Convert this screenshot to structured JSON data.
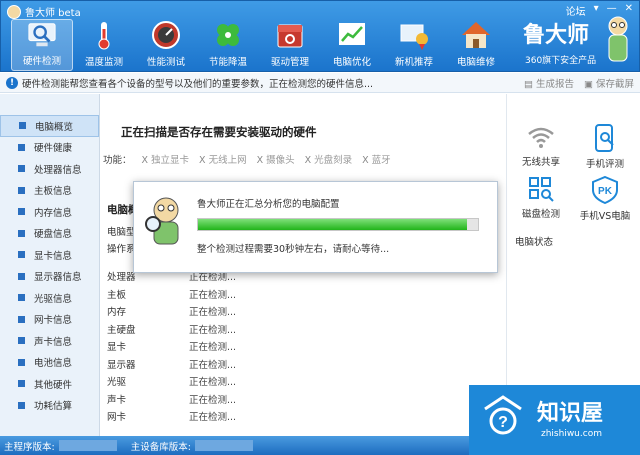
{
  "app": {
    "title": "鲁大师 beta",
    "window_controls": [
      "论坛",
      "▾",
      "—",
      "✕"
    ]
  },
  "nav": {
    "items": [
      {
        "label": "硬件检测",
        "icon": "hardware-check-icon",
        "active": true
      },
      {
        "label": "温度监测",
        "icon": "thermometer-icon",
        "active": false
      },
      {
        "label": "性能测试",
        "icon": "gauge-icon",
        "active": false
      },
      {
        "label": "节能降温",
        "icon": "clover-icon",
        "active": false
      },
      {
        "label": "驱动管理",
        "icon": "driver-box-icon",
        "active": false
      },
      {
        "label": "电脑优化",
        "icon": "chart-icon",
        "active": false
      },
      {
        "label": "新机推荐",
        "icon": "computer-award-icon",
        "active": false
      },
      {
        "label": "电脑维修",
        "icon": "house-icon",
        "active": false
      }
    ]
  },
  "brand": {
    "name": "鲁大师",
    "subtitle": "360旗下安全产品"
  },
  "infobar": {
    "text": "硬件检测能帮您查看各个设备的型号以及他们的重要参数，正在检测您的硬件信息...",
    "actions": [
      "生成报告",
      "保存截屏"
    ]
  },
  "sidebar": {
    "items": [
      {
        "label": "电脑概览",
        "active": true
      },
      {
        "label": "硬件健康"
      },
      {
        "label": "处理器信息"
      },
      {
        "label": "主板信息"
      },
      {
        "label": "内存信息"
      },
      {
        "label": "硬盘信息"
      },
      {
        "label": "显卡信息"
      },
      {
        "label": "显示器信息"
      },
      {
        "label": "光驱信息"
      },
      {
        "label": "网卡信息"
      },
      {
        "label": "声卡信息"
      },
      {
        "label": "电池信息"
      },
      {
        "label": "其他硬件"
      },
      {
        "label": "功耗估算"
      }
    ]
  },
  "main": {
    "scan_title": "正在扫描是否存在需要安装驱动的硬件",
    "functions_label": "功能：",
    "functions": [
      "独立显卡",
      "无线上网",
      "摄像头",
      "光盘刻录",
      "蓝牙"
    ],
    "section_title": "电脑概览",
    "partial_rows": [
      "电脑型号",
      "操作系统"
    ],
    "rows": [
      {
        "key": "处理器",
        "value": "正在检测..."
      },
      {
        "key": "主板",
        "value": "正在检测..."
      },
      {
        "key": "内存",
        "value": "正在检测..."
      },
      {
        "key": "主硬盘",
        "value": "正在检测..."
      },
      {
        "key": "显卡",
        "value": "正在检测..."
      },
      {
        "key": "显示器",
        "value": "正在检测..."
      },
      {
        "key": "光驱",
        "value": "正在检测..."
      },
      {
        "key": "声卡",
        "value": "正在检测..."
      },
      {
        "key": "网卡",
        "value": "正在检测..."
      }
    ]
  },
  "right_panel": {
    "tools": [
      {
        "label": "无线共享",
        "icon": "wifi-icon"
      },
      {
        "label": "手机评测",
        "icon": "phone-test-icon"
      },
      {
        "label": "磁盘检测",
        "icon": "disk-check-icon"
      },
      {
        "label": "手机VS电脑",
        "icon": "pk-icon"
      }
    ],
    "status_label": "电脑状态"
  },
  "modal": {
    "title": "鲁大师正在汇总分析您的电脑配置",
    "progress_fraction": 0.96,
    "message": "整个检测过程需要30秒钟左右，请耐心等待..."
  },
  "statusbar": {
    "main_version_label": "主程序版本:",
    "db_version_label": "主设备库版本:"
  },
  "watermark": {
    "name": "知识屋",
    "url": "zhishiwu.com"
  },
  "colors": {
    "toolbar_blue": "#1b74cc",
    "progress_green": "#21b41a",
    "watermark_blue": "#1e88d8"
  }
}
